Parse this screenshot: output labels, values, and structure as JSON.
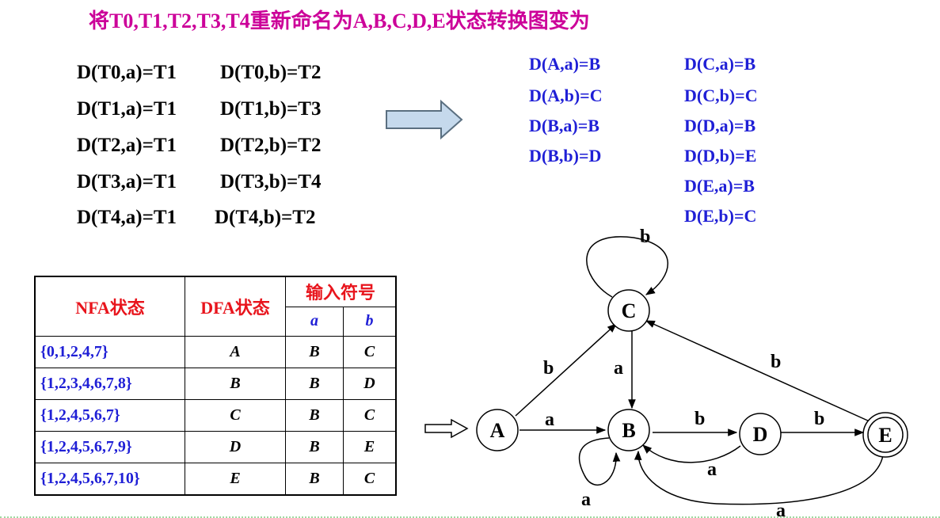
{
  "title": "将T0,T1,T2,T3,T4重新命名为A,B,C,D,E状态转换图变为",
  "transitions_old": [
    {
      "a": "D(T0,a)=T1",
      "b": "D(T0,b)=T2"
    },
    {
      "a": "D(T1,a)=T1",
      "b": "D(T1,b)=T3"
    },
    {
      "a": "D(T2,a)=T1",
      "b": "D(T2,b)=T2"
    },
    {
      "a": "D(T3,a)=T1",
      "b": "D(T3,b)=T4"
    },
    {
      "a": "D(T4,a)=T1",
      "b": "D(T4,b)=T2"
    }
  ],
  "transitions_new_col1": [
    "D(A,a)=B",
    "D(A,b)=C",
    "D(B,a)=B",
    "D(B,b)=D"
  ],
  "transitions_new_col2": [
    "D(C,a)=B",
    "D(C,b)=C",
    "D(D,a)=B",
    "D(D,b)=E",
    "D(E,a)=B",
    "D(E,b)=C"
  ],
  "table": {
    "headers": {
      "nfa": "NFA状态",
      "dfa": "DFA状态",
      "input": "输入符号",
      "a": "a",
      "b": "b"
    },
    "rows": [
      {
        "nfa": "{0,1,2,4,7}",
        "dfa": "A",
        "a": "B",
        "b": "C"
      },
      {
        "nfa": "{1,2,3,4,6,7,8}",
        "dfa": "B",
        "a": "B",
        "b": "D"
      },
      {
        "nfa": "{1,2,4,5,6,7}",
        "dfa": "C",
        "a": "B",
        "b": "C"
      },
      {
        "nfa": "{1,2,4,5,6,7,9}",
        "dfa": "D",
        "a": "B",
        "b": "E"
      },
      {
        "nfa": "{1,2,4,5,6,7,10}",
        "dfa": "E",
        "a": "B",
        "b": "C"
      }
    ]
  },
  "diagram": {
    "states": {
      "A": "A",
      "B": "B",
      "C": "C",
      "D": "D",
      "E": "E"
    },
    "edge_labels": {
      "C_self": "b",
      "A_C": "b",
      "C_B": "a",
      "E_C": "b",
      "A_B": "a",
      "B_D": "b",
      "D_E": "b",
      "D_B": "a",
      "B_self": "a",
      "E_B": "a"
    }
  },
  "colors": {
    "title": "#cc0099",
    "blue": "#1f1fd6",
    "red": "#e8141c",
    "arrow_fill": "#c5d9ec",
    "arrow_stroke": "#5a6f80"
  }
}
